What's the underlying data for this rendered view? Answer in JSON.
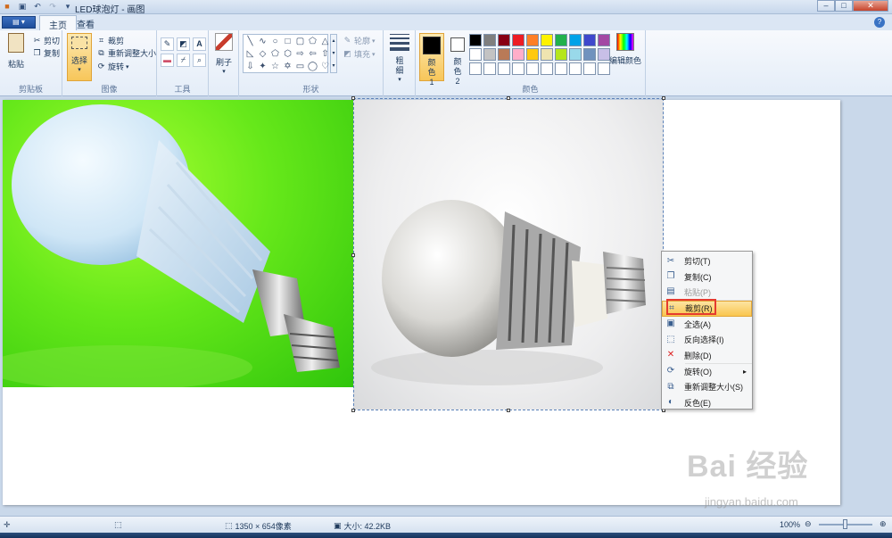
{
  "window": {
    "title": "LED球泡灯 - 画图"
  },
  "tabs": {
    "home": "主页",
    "view": "查看"
  },
  "ribbon": {
    "clipboard": {
      "label": "剪贴板",
      "paste": "粘贴",
      "cut": "剪切",
      "copy": "复制"
    },
    "image": {
      "label": "图像",
      "select": "选择",
      "crop": "裁剪",
      "resize": "重新调整大小",
      "rotate": "旋转"
    },
    "tools": {
      "label": "工具"
    },
    "brushes": {
      "label": "刷子"
    },
    "shapes": {
      "label": "形状",
      "outline": "轮廓",
      "fill": "填充"
    },
    "size": {
      "label": "粗细"
    },
    "colors": {
      "label": "颜色",
      "color1": "颜色 1",
      "color2": "颜色 2",
      "edit": "编辑颜色",
      "color1_value": "#000000",
      "color2_value": "#ffffff",
      "palette": [
        "#000000",
        "#7f7f7f",
        "#880015",
        "#ed1c24",
        "#ff7f27",
        "#fff200",
        "#22b14c",
        "#00a2e8",
        "#3f48cc",
        "#a349a4",
        "#ffffff",
        "#c3c3c3",
        "#b97a57",
        "#ffaec9",
        "#ffc90e",
        "#efe4b0",
        "#b5e61d",
        "#99d9ea",
        "#7092be",
        "#c8bfe7",
        "#ffffff",
        "#ffffff",
        "#ffffff",
        "#ffffff",
        "#ffffff",
        "#ffffff",
        "#ffffff",
        "#ffffff",
        "#ffffff",
        "#ffffff"
      ]
    }
  },
  "context_menu": {
    "items": [
      {
        "label": "剪切(T)",
        "icon": "scissors-icon",
        "disabled": false
      },
      {
        "label": "复制(C)",
        "icon": "copy-icon",
        "disabled": false
      },
      {
        "label": "粘贴(P)",
        "icon": "paste-icon",
        "disabled": true
      },
      {
        "label": "裁剪(R)",
        "icon": "crop-icon",
        "disabled": false,
        "highlighted": true
      },
      {
        "label": "全选(A)",
        "icon": "select-all-icon",
        "disabled": false
      },
      {
        "label": "反向选择(I)",
        "icon": "invert-selection-icon",
        "disabled": false
      },
      {
        "label": "删除(D)",
        "icon": "delete-icon",
        "disabled": false
      },
      {
        "label": "旋转(O)",
        "icon": "rotate-icon",
        "disabled": false,
        "submenu": true
      },
      {
        "label": "重新调整大小(S)",
        "icon": "resize-icon",
        "disabled": false
      },
      {
        "label": "反色(E)",
        "icon": "invert-color-icon",
        "disabled": false
      }
    ]
  },
  "statusbar": {
    "dimensions": "1350 × 654像素",
    "filesize": "大小: 42.2KB",
    "zoom": "100%"
  },
  "watermark": {
    "brand": "Bai 经验",
    "url": "jingyan.baidu.com"
  }
}
